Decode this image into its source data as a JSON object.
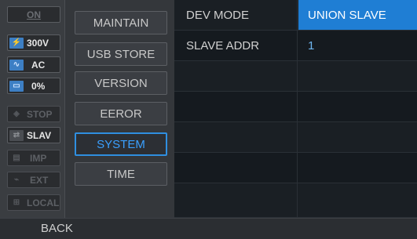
{
  "status": {
    "on": "ON",
    "voltage": "300V",
    "mode": "AC",
    "percent": "0%",
    "stop": "STOP",
    "slav": "SLAV",
    "imp": "IMP",
    "ext": "EXT",
    "local": "LOCAL"
  },
  "menu": {
    "maintain": "MAINTAIN",
    "usb_store": "USB STORE",
    "version": "VERSION",
    "eeror": "EEROR",
    "system": "SYSTEM",
    "time": "TIME"
  },
  "table": {
    "rows": [
      {
        "label": "DEV MODE",
        "value": "UNION SLAVE"
      },
      {
        "label": "SLAVE ADDR",
        "value": "1"
      }
    ]
  },
  "footer": {
    "back": "BACK"
  },
  "colors": {
    "accent": "#1f7ed4",
    "selected_border": "#2f8fe0"
  }
}
